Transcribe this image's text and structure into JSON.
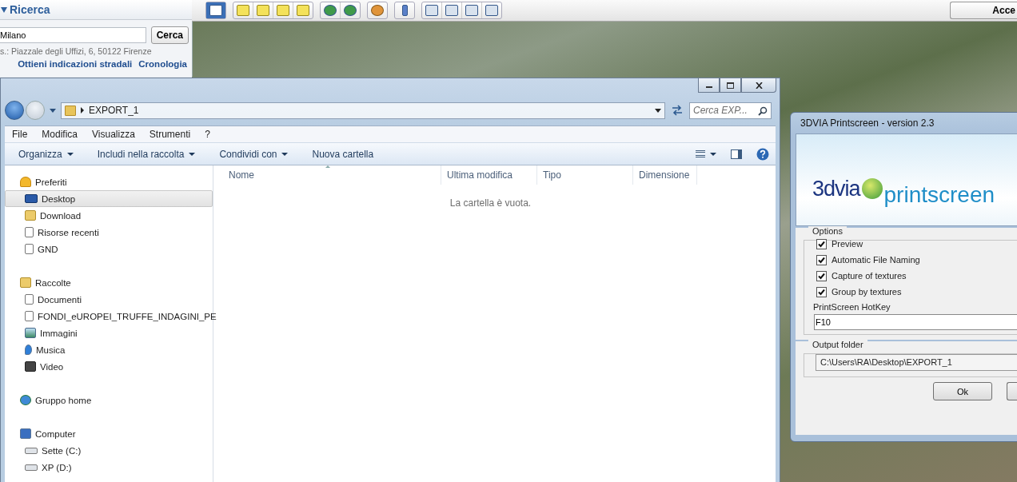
{
  "search_panel": {
    "title": "Ricerca",
    "query": "Milano",
    "button": "Cerca",
    "hint": "s.: Piazzale degli Uffizi, 6, 50122 Firenze",
    "links": [
      "Ottieni indicazioni stradali",
      "Cronologia"
    ]
  },
  "top_button": {
    "label": "Acce"
  },
  "explorer": {
    "path": "EXPORT_1",
    "search_placeholder": "Cerca EXP...",
    "menu": [
      "File",
      "Modifica",
      "Visualizza",
      "Strumenti",
      "?"
    ],
    "commands": [
      {
        "label": "Organizza",
        "dropdown": true
      },
      {
        "label": "Includi nella raccolta",
        "dropdown": true
      },
      {
        "label": "Condividi con",
        "dropdown": true
      },
      {
        "label": "Nuova cartella",
        "dropdown": false
      }
    ],
    "sidebar": [
      {
        "label": "Preferiti",
        "selected": false,
        "children": [
          {
            "label": "Desktop",
            "selected": true
          },
          {
            "label": "Download",
            "selected": false
          },
          {
            "label": "Risorse recenti",
            "selected": false
          },
          {
            "label": "GND",
            "selected": false
          }
        ]
      },
      {
        "label": "Raccolte",
        "selected": false,
        "children": [
          {
            "label": "Documenti",
            "selected": false
          },
          {
            "label": "FONDI_eUROPEI_TRUFFE_INDAGINI_PE",
            "selected": false
          },
          {
            "label": "Immagini",
            "selected": false
          },
          {
            "label": "Musica",
            "selected": false
          },
          {
            "label": "Video",
            "selected": false
          }
        ]
      },
      {
        "label": "Gruppo home",
        "selected": false
      },
      {
        "label": "Computer",
        "selected": false,
        "children": [
          {
            "label": "Sette (C:)",
            "selected": false
          },
          {
            "label": "XP (D:)",
            "selected": false
          }
        ]
      }
    ],
    "columns": [
      {
        "label": "Nome",
        "sorted": true
      },
      {
        "label": "Ultima modifica",
        "sorted": false
      },
      {
        "label": "Tipo",
        "sorted": false
      },
      {
        "label": "Dimensione",
        "sorted": false
      }
    ],
    "empty_message": "La cartella è vuota."
  },
  "dialog": {
    "title": "3DVIA Printscreen - version 2.3",
    "logo_left": "3dvia",
    "logo_right": "printscreen",
    "options_title": "Options",
    "options": [
      {
        "label": "Preview",
        "checked": true
      },
      {
        "label": "Automatic File Naming",
        "checked": true
      },
      {
        "label": "Capture of textures",
        "checked": true
      },
      {
        "label": "Group by textures",
        "checked": true
      }
    ],
    "hotkey_label": "PrintScreen HotKey",
    "hotkey": "F10",
    "output_title": "Output folder",
    "output_path": "C:\\Users\\RA\\Desktop\\EXPORT_1",
    "ok": "Ok"
  }
}
